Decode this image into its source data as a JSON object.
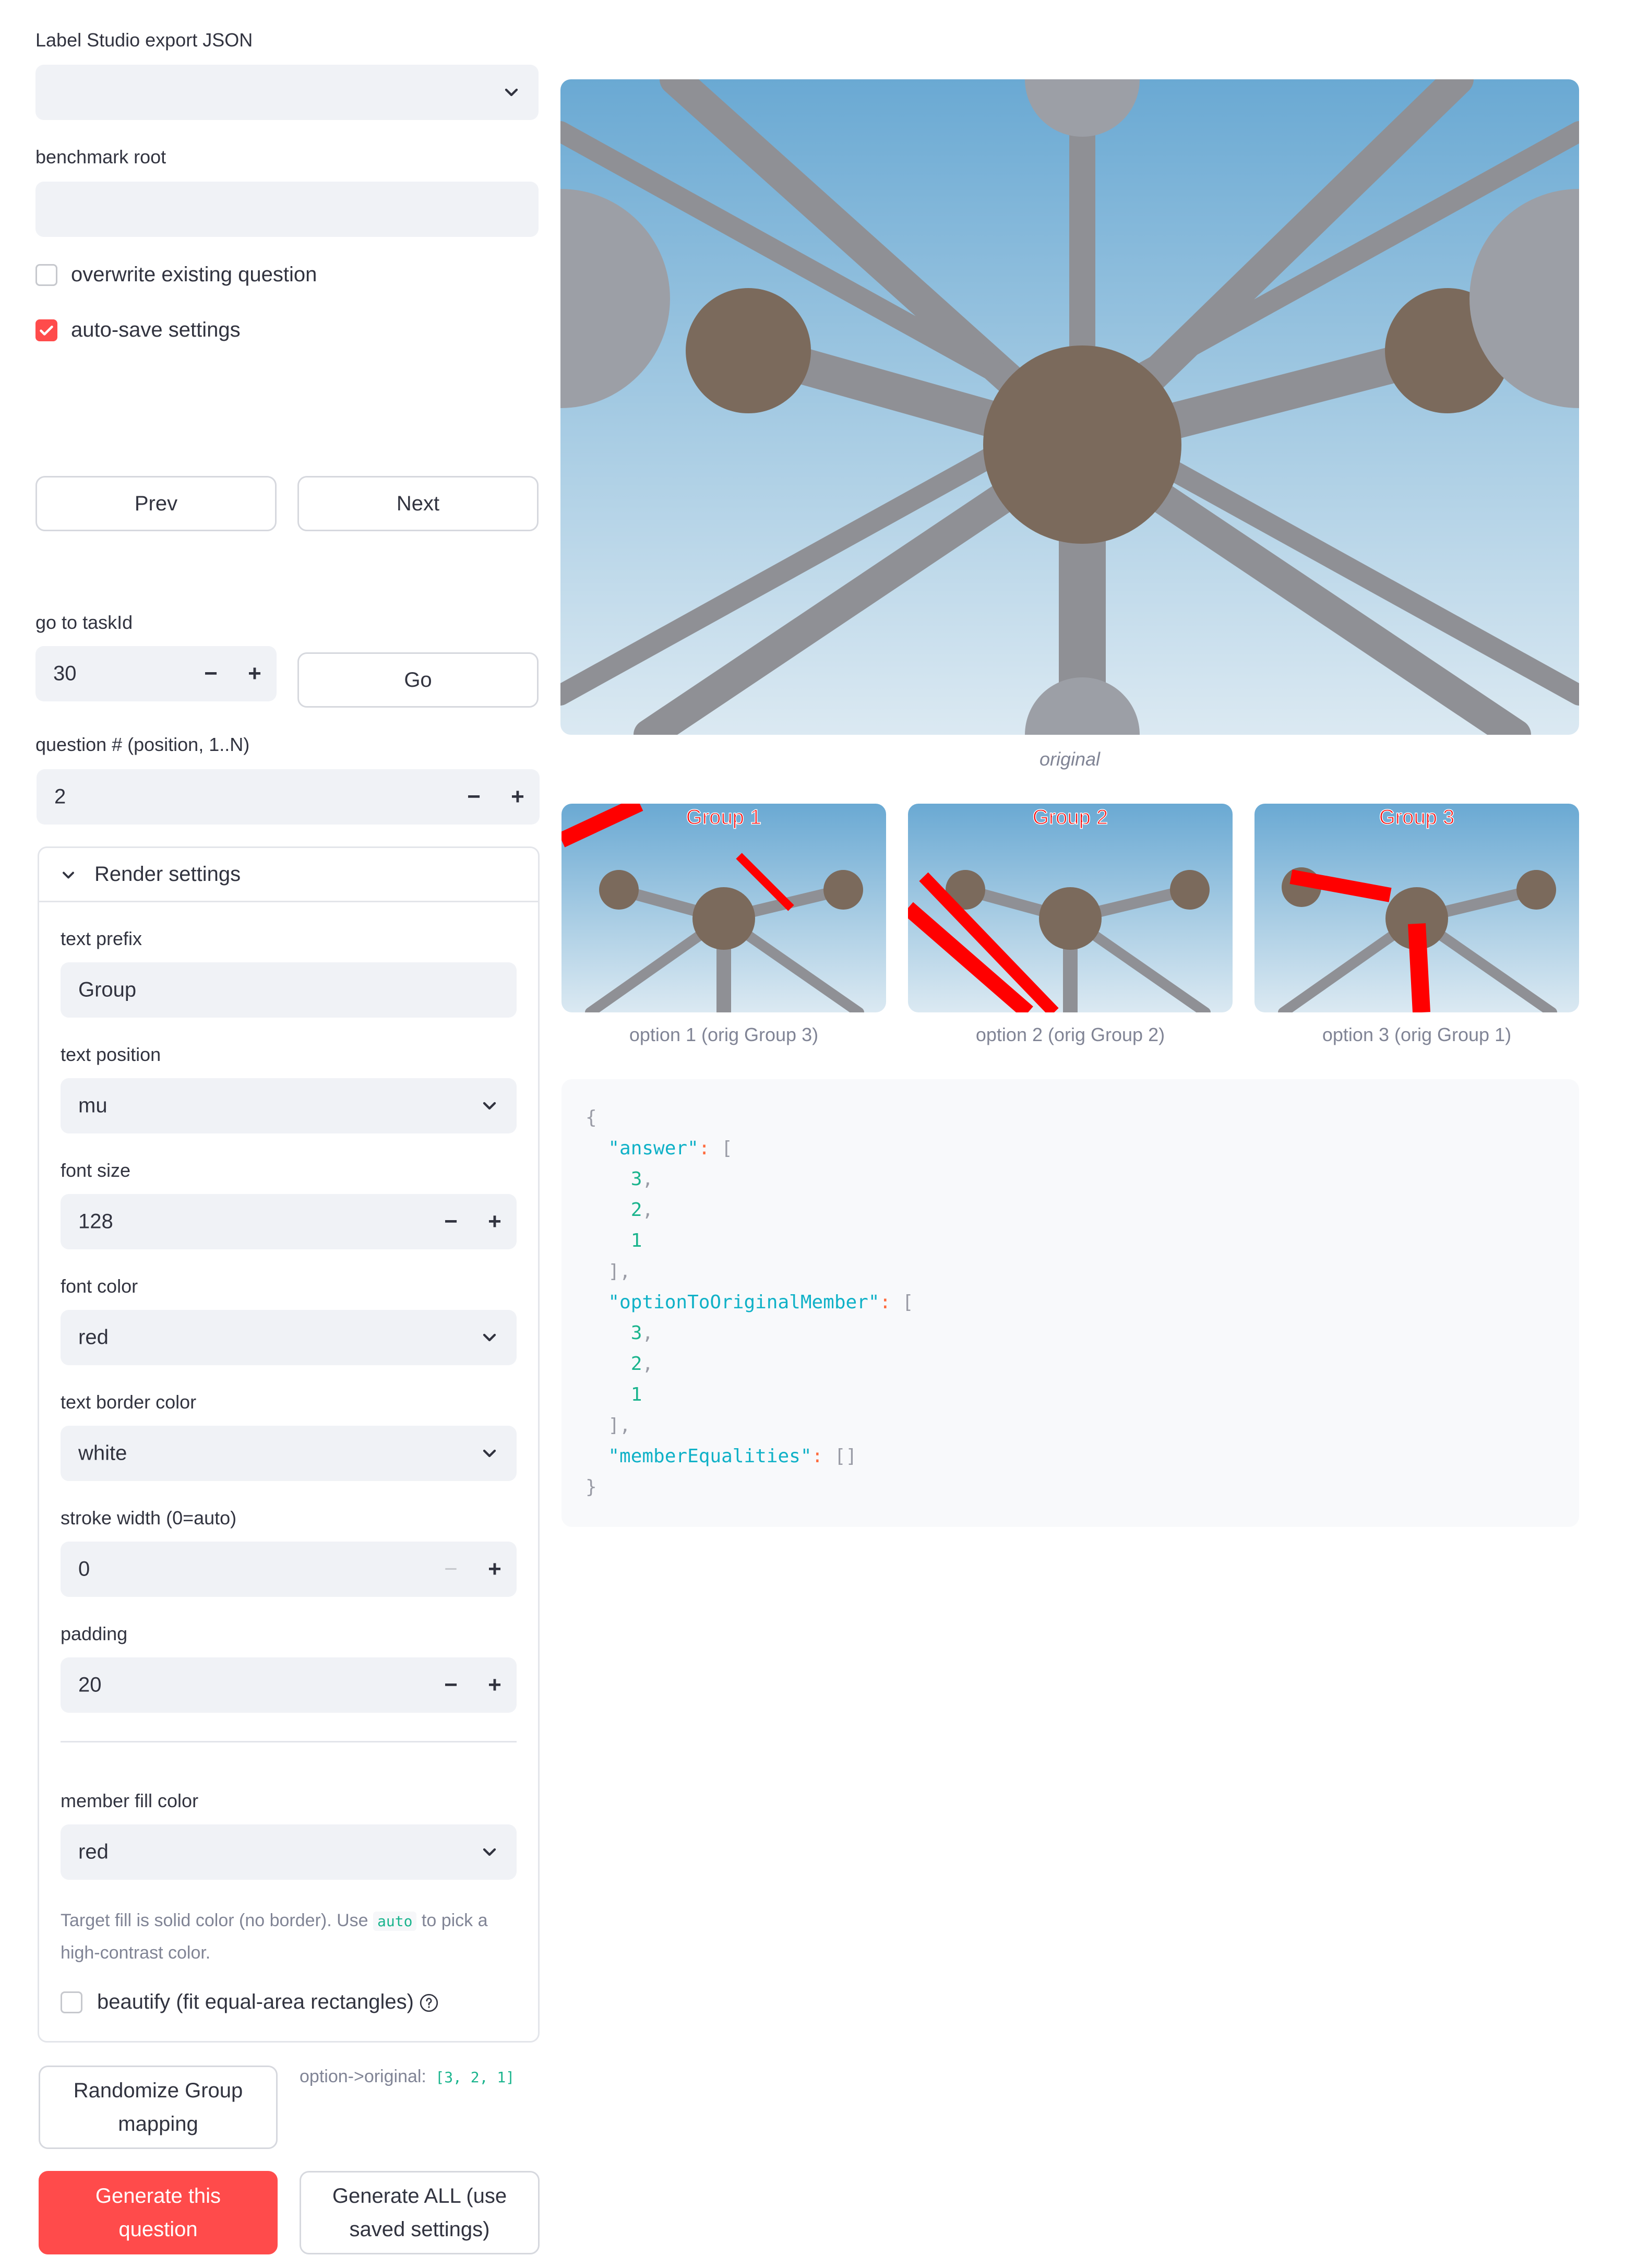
{
  "left": {
    "export_json_label": "Label Studio export JSON",
    "export_json_value": "",
    "benchmark_root_label": "benchmark root",
    "benchmark_root_value": "",
    "overwrite_label": "overwrite existing question",
    "overwrite_checked": false,
    "autosave_label": "auto-save settings",
    "autosave_checked": true,
    "prev_label": "Prev",
    "next_label": "Next",
    "goto_label": "go to taskId",
    "goto_value": "30",
    "go_label": "Go",
    "question_label": "question # (position, 1..N)",
    "question_value": "2"
  },
  "render_settings": {
    "title": "Render settings",
    "text_prefix_label": "text prefix",
    "text_prefix_value": "Group",
    "text_position_label": "text position",
    "text_position_value": "mu",
    "font_size_label": "font size",
    "font_size_value": "128",
    "font_color_label": "font color",
    "font_color_value": "red",
    "text_border_color_label": "text border color",
    "text_border_color_value": "white",
    "stroke_width_label": "stroke width (0=auto)",
    "stroke_width_value": "0",
    "padding_label": "padding",
    "padding_value": "20",
    "member_fill_label": "member fill color",
    "member_fill_value": "red",
    "help_pre": "Target fill is solid color (no border). Use",
    "help_code": "auto",
    "help_post": "to pick a",
    "help_line2": "high-contrast color.",
    "beautify_label": "beautify (fit equal-area rectangles)",
    "beautify_checked": false
  },
  "actions": {
    "randomize_line1": "Randomize Group",
    "randomize_line2": "mapping",
    "mapping_label": "option->original:",
    "mapping_value": "[3, 2, 1]",
    "generate_line1": "Generate this",
    "generate_line2": "question",
    "generate_all_line1": "Generate ALL (use",
    "generate_all_line2": "saved settings)"
  },
  "preview": {
    "original_caption": "original",
    "options": [
      {
        "overlay": "Group 1",
        "caption": "option 1 (orig Group 3)"
      },
      {
        "overlay": "Group 2",
        "caption": "option 2 (orig Group 2)"
      },
      {
        "overlay": "Group 3",
        "caption": "option 3 (orig Group 1)"
      }
    ]
  },
  "json_output": {
    "answer_key": "\"answer\"",
    "answer": [
      "3",
      "2",
      "1"
    ],
    "mapping_key": "\"optionToOriginalMember\"",
    "mapping": [
      "3",
      "2",
      "1"
    ],
    "equalities_key": "\"memberEqualities\"",
    "equalities_value": "[]"
  },
  "colors": {
    "primary": "#ff4b4b",
    "field_bg": "#f0f2f6",
    "json_key": "#0fb1c7",
    "json_number": "#1ab48d"
  }
}
